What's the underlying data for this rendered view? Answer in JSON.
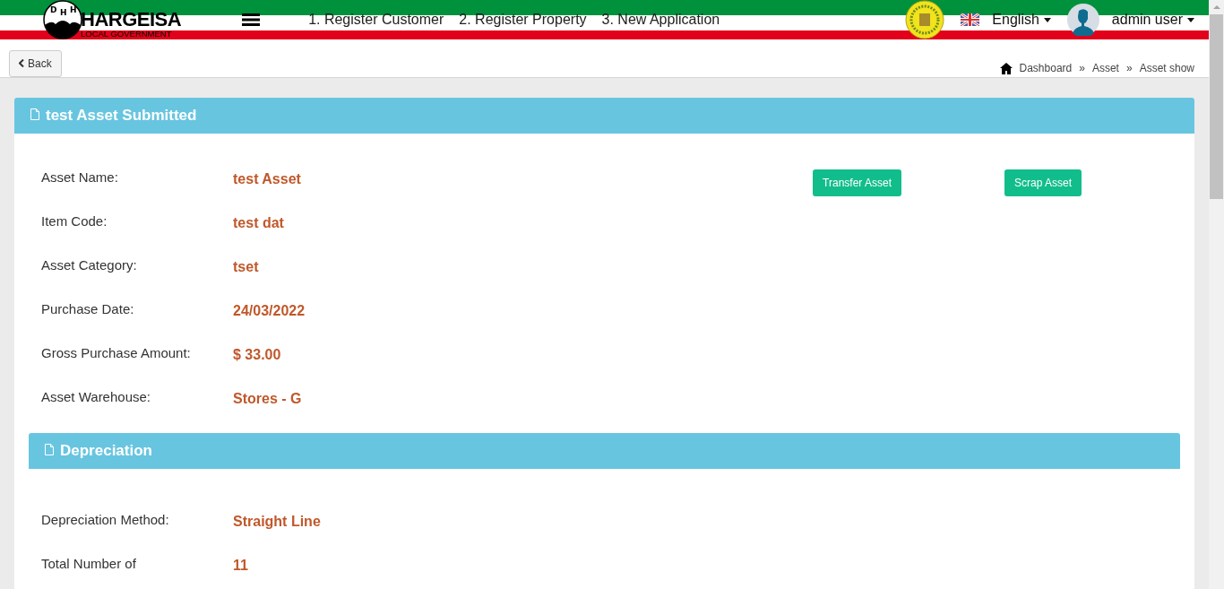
{
  "header": {
    "logo_letters": [
      "D",
      "H",
      "H"
    ],
    "logo_title": "HARGEISA",
    "logo_subtitle": "LOCAL GOVERNMENT",
    "nav_links": [
      "1. Register Customer",
      "2. Register Property",
      "3. New Application"
    ],
    "language": "English",
    "user": "admin user"
  },
  "back_button": "Back",
  "breadcrumb": [
    "Dashboard",
    "Asset",
    "Asset show"
  ],
  "breadcrumb_separators": [
    "»",
    "»"
  ],
  "asset_panel": {
    "title": "test Asset Submitted",
    "fields": [
      {
        "label": "Asset Name:",
        "value": "test Asset"
      },
      {
        "label": "Item Code:",
        "value": "test dat"
      },
      {
        "label": "Asset Category:",
        "value": "tset"
      },
      {
        "label": "Purchase Date:",
        "value": "24/03/2022"
      },
      {
        "label": "Gross Purchase Amount:",
        "value": "$ 33.00"
      },
      {
        "label": "Asset Warehouse:",
        "value": "Stores - G"
      }
    ],
    "buttons": [
      "Transfer Asset",
      "Scrap Asset"
    ]
  },
  "depreciation_panel": {
    "title": "Depreciation",
    "fields": [
      {
        "label": "Depreciation Method:",
        "value": "Straight Line"
      },
      {
        "label": "Total Number of",
        "value": "11"
      }
    ]
  }
}
